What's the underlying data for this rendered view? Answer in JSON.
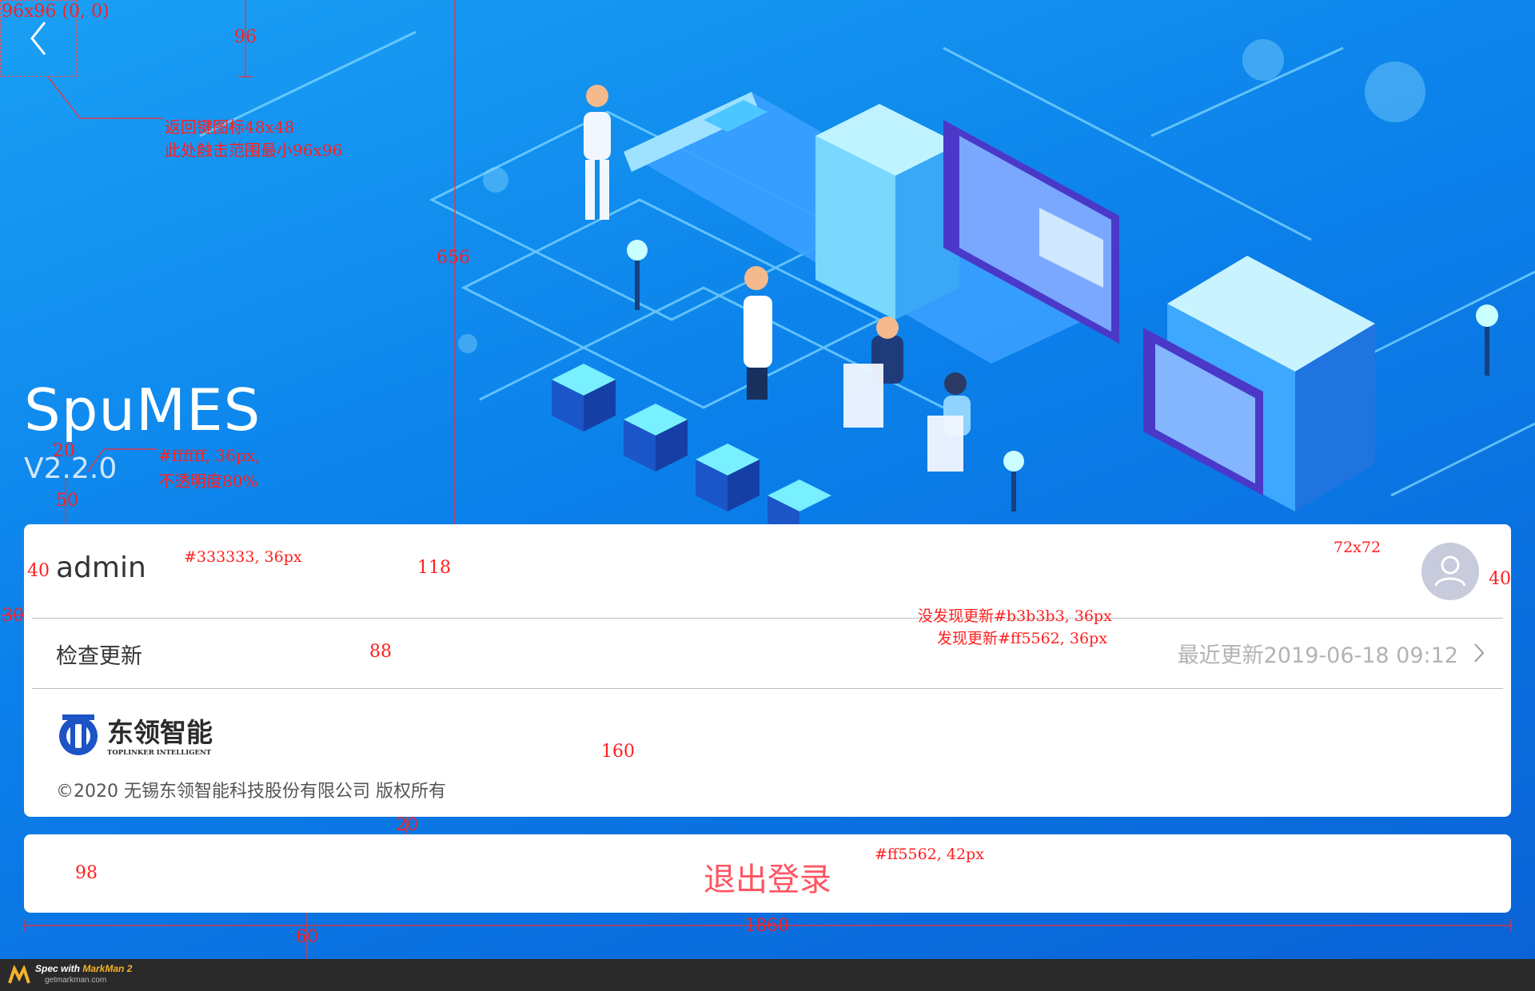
{
  "app": {
    "name": "SpuMES",
    "version": "V2.2.0"
  },
  "user": {
    "name": "admin"
  },
  "update": {
    "label": "检查更新",
    "status": "最近更新2019-06-18 09:12"
  },
  "company": {
    "logo_cn": "东领智能",
    "logo_en": "TOPLINKER INTELLIGENT",
    "copyright": "©2020 无锡东领智能科技股份有限公司 版权所有"
  },
  "logout": {
    "label": "退出登录"
  },
  "colors": {
    "logout_text": "#ff5562",
    "no_update_text": "#b3b3b3",
    "username_text": "#333333",
    "version_text": "#ffffff",
    "annotation": "#ff1f1f"
  },
  "icons": {
    "back": "chevron-left-icon",
    "avatar": "user-icon",
    "update_arrow": "chevron-right-icon",
    "logo_mark": "gear-logo-icon"
  },
  "annotations": {
    "back_size": "96x96 (0, 0)",
    "back_height": "96",
    "back_note_1": "返回键图标48x48",
    "back_note_2": "此处触击范围最小96x96",
    "banner_height": "656",
    "version_gap": "20",
    "version_note_1": "#ffffff, 36px,",
    "version_note_2": "不透明度80%",
    "card_gap": "50",
    "user_left": "40",
    "username_note": "#333333, 36px",
    "user_row_height": "118",
    "avatar_size": "72x72",
    "avatar_right": "40",
    "card_left": "30",
    "update_none_note": "没发现更新#b3b3b3, 36px",
    "update_found_note": "发现更新#ff5562, 36px",
    "update_row_height": "88",
    "company_row_height": "160",
    "logout_gap": "20",
    "logout_height": "98",
    "logout_note": "#ff5562, 42px",
    "content_width": "1860",
    "bottom_gap": "60"
  },
  "footer": {
    "spec_text": "Spec with ",
    "brand": "MarkMan 2",
    "site": "getmarkman.com"
  }
}
